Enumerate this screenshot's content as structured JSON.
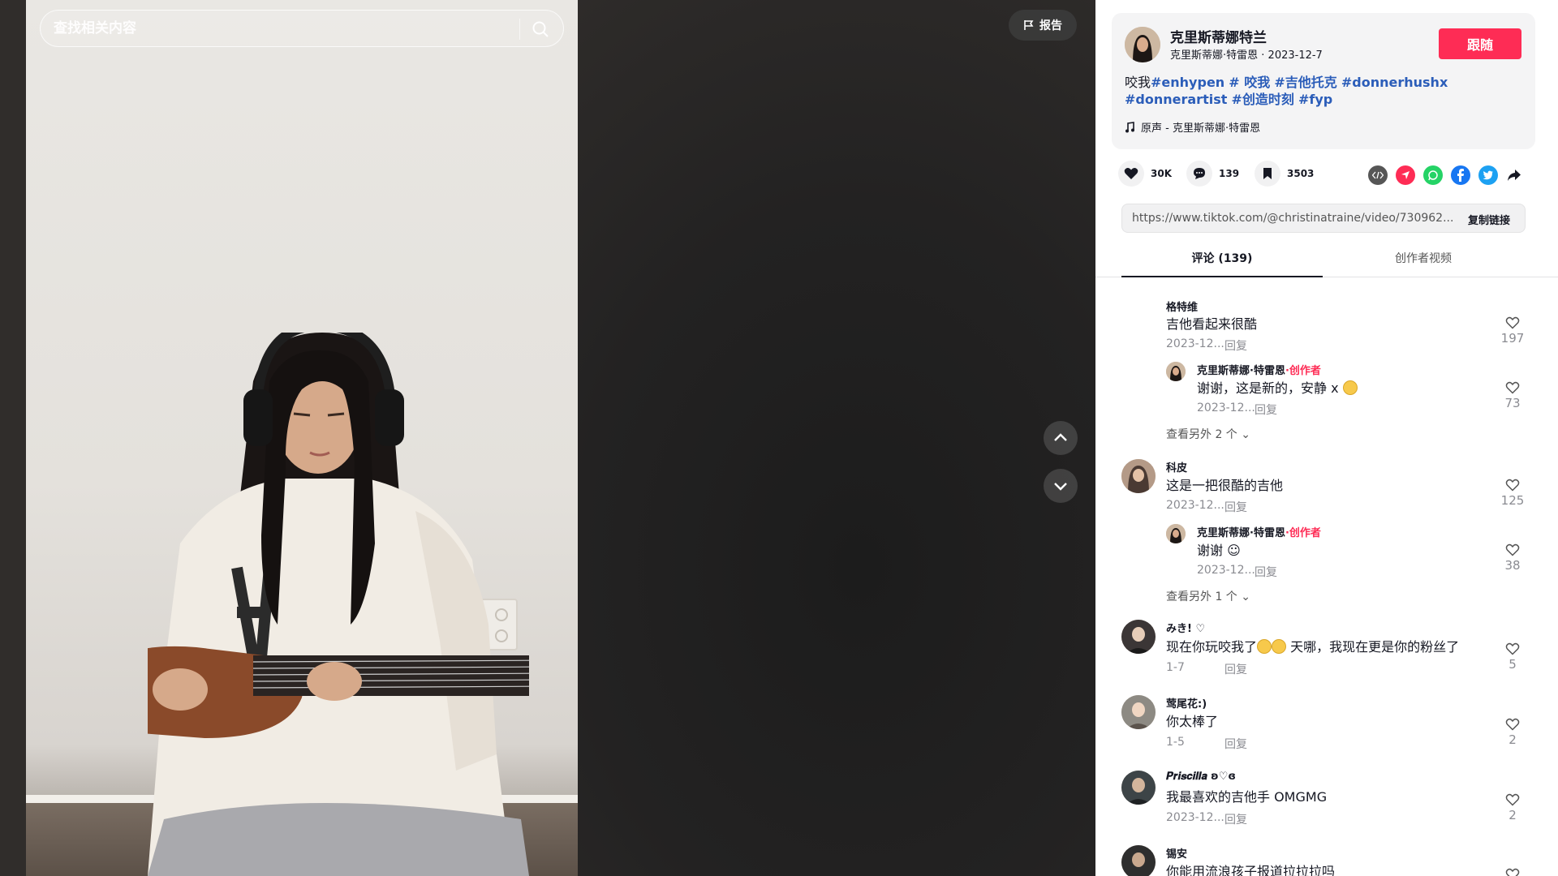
{
  "search": {
    "placeholder": "查找相关内容"
  },
  "video": {
    "report_label": "报告"
  },
  "author": {
    "name": "克里斯蒂娜特兰",
    "handle": "克里斯蒂娜·特雷恩",
    "date": "2023-12-7",
    "follow_label": "跟随"
  },
  "caption": {
    "prefix": "咬我",
    "tags": [
      "#enhypen",
      "# 咬我",
      "#吉他托克",
      "#donnerhushx",
      "#donnerartist",
      "#创造时刻",
      "#fyp"
    ]
  },
  "music": {
    "label": "原声 - 克里斯蒂娜·特雷恩"
  },
  "stats": {
    "likes": "30K",
    "comments": "139",
    "saves": "3503"
  },
  "share": {
    "icons": [
      "embed-icon",
      "send-icon",
      "whatsapp-icon",
      "facebook-icon",
      "twitter-icon",
      "share-arrow-icon"
    ]
  },
  "link": {
    "url": "https://www.tiktok.com/@christinatraine/video/730962...",
    "copy_label": "复制链接"
  },
  "tabs": {
    "comments": "评论 (139)",
    "creator_videos": "创作者视频"
  },
  "comments": [
    {
      "user": "格特维",
      "text": "吉他看起来很酷",
      "date": "2023-12...",
      "reply": "回复",
      "likes": "197",
      "sub": {
        "user": "克里斯蒂娜·特雷恩",
        "tag": "·创作者",
        "text": "谢谢，这是新的，安静 x",
        "date": "2023-12...",
        "reply": "回复",
        "likes": "73"
      },
      "more": "查看另外 2 个"
    },
    {
      "user": "科皮",
      "text": "这是一把很酷的吉他",
      "date": "2023-12...",
      "reply": "回复",
      "likes": "125",
      "sub": {
        "user": "克里斯蒂娜·特雷恩",
        "tag": "·创作者",
        "text": "谢谢",
        "date": "2023-12...",
        "reply": "回复",
        "likes": "38"
      },
      "more": "查看另外 1 个"
    },
    {
      "user": "みき! ♡",
      "text": "现在你玩咬我了",
      "text2": "天哪，我现在更是你的粉丝了",
      "date": "1-7",
      "reply": "回复",
      "likes": "5"
    },
    {
      "user": "莺尾花:)",
      "text": "你太棒了",
      "date": "1-5",
      "reply": "回复",
      "likes": "2"
    },
    {
      "user": "𝑷𝒓𝒊𝒔𝒄𝒊𝒍𝒍𝒂 ʚ♡ɞ",
      "text": "我最喜欢的吉他手 OMGMG",
      "date": "2023-12...",
      "reply": "回复",
      "likes": "2"
    },
    {
      "user": "锡安",
      "text": "你能用流浪孩子报道拉拉拉吗",
      "date": "",
      "reply": "",
      "likes": ""
    }
  ]
}
